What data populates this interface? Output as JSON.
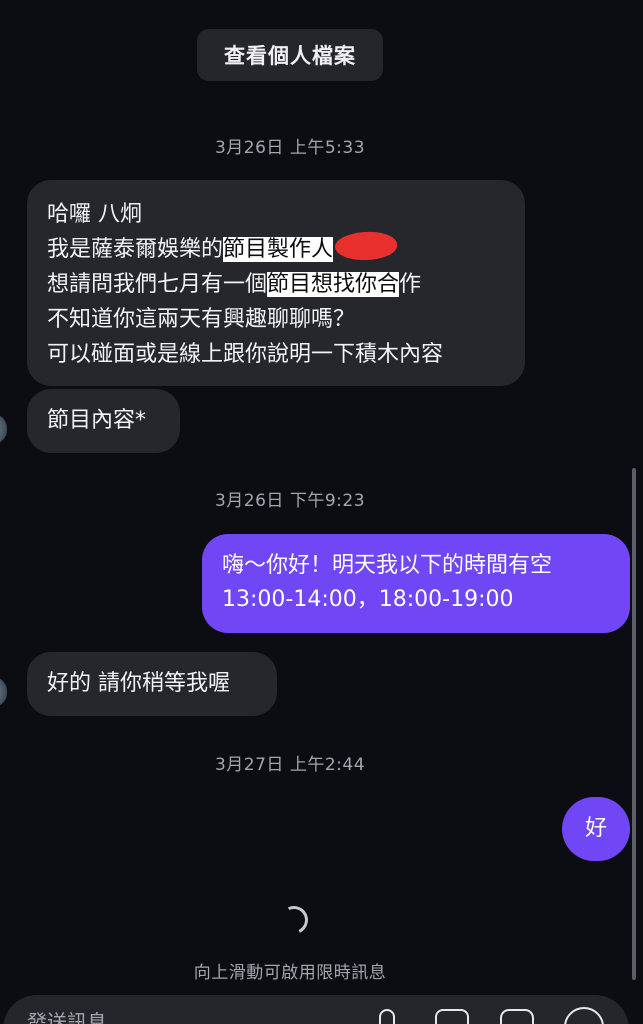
{
  "header": {
    "view_profile_label": "查看個人檔案"
  },
  "timestamps": [
    "3月26日 上午5:33",
    "3月26日 下午9:23",
    "3月27日 上午2:44"
  ],
  "messages": {
    "m1": {
      "line1": "哈囉 八炯",
      "line2_pre": "我是薩泰爾娛樂的",
      "line2_hl": "節目製作人",
      "line3_pre": "想請問我們七月有一個",
      "line3_hl": "節目想找你合",
      "line3_post": "作",
      "line4": "不知道你這兩天有興趣聊聊嗎？",
      "line5": "可以碰面或是線上跟你說明一下積木內容"
    },
    "m2": "節目內容*",
    "m3": {
      "line1": "嗨～你好！明天我以下的時間有空",
      "line2": "13:00-14:00，18:00-19:00"
    },
    "m4": "好的 請你稍等我喔",
    "m5": "好"
  },
  "footer": {
    "hint": "向上滑動可啟用限時訊息",
    "placeholder": "發送訊息"
  },
  "colors": {
    "background": "#0c0d12",
    "incoming_bubble": "#26272d",
    "outgoing_bubble": "#7046f5",
    "redaction": "#e8302c"
  },
  "icons": [
    "mic-icon",
    "image-icon",
    "sticker-icon",
    "plus-icon"
  ]
}
